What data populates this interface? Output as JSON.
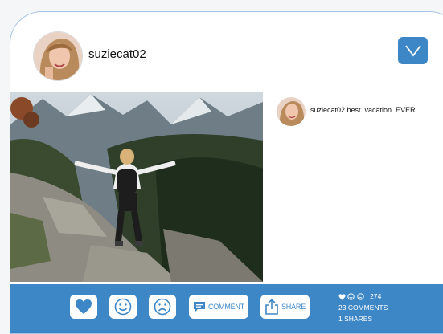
{
  "post": {
    "username": "suziecat02",
    "caption": "suziecat02 best. vacation. EVER."
  },
  "actions": {
    "like_label": "",
    "comment_label": "COMMENT",
    "share_label": "SHARE"
  },
  "stats": {
    "reactions_count": "274",
    "comments": "23 COMMENTS",
    "shares": "1 SHARES"
  },
  "icons": {
    "dropdown": "chevron-down-icon",
    "like": "heart-icon",
    "happy": "smiley-icon",
    "sad": "frown-icon",
    "comment": "comment-bubble-icon",
    "share": "share-icon"
  },
  "colors": {
    "accent": "#3d87c6",
    "border": "#a9c4e3"
  }
}
